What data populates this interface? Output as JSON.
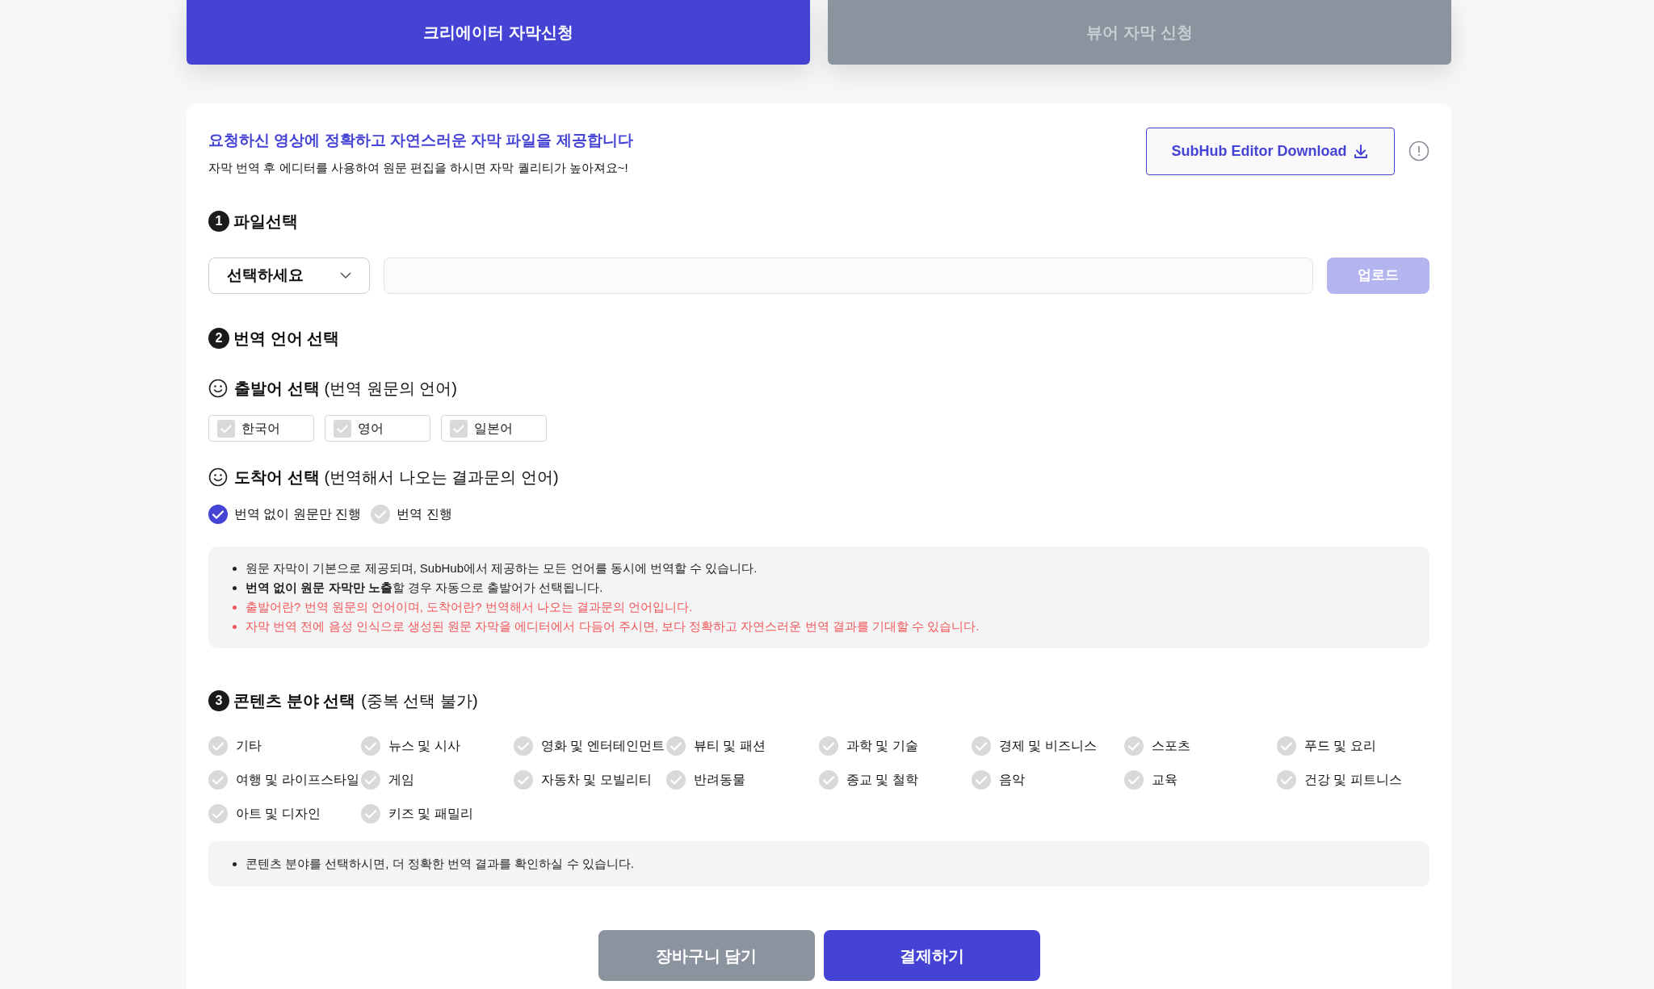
{
  "tabs": [
    {
      "label": "크리에이터 자막신청",
      "selected": true
    },
    {
      "label": "뷰어 자막 신청",
      "selected": false
    }
  ],
  "intro": {
    "title": "요청하신 영상에 정확하고 자연스러운 자막 파일을 제공합니다",
    "subtitle": "자막 번역 후 에디터를 사용하여 원문 편집을 하시면 자막 퀄리티가 높아져요~!",
    "download_button": "SubHub Editor Download"
  },
  "file_section": {
    "number": "1",
    "title": "파일선택",
    "select": "선택하세요",
    "upload_button": "업로드",
    "upload_disabled": true
  },
  "language_section": {
    "number": "2",
    "title": "번역 언어 선택",
    "source": {
      "title": "출발어 선택",
      "hint": "(번역 원문의 언어)",
      "options": [
        {
          "label": "한국어",
          "checked": false
        },
        {
          "label": "영어",
          "checked": false
        },
        {
          "label": "일본어",
          "checked": false
        }
      ]
    },
    "target": {
      "title": "도착어 선택",
      "hint": "(번역해서 나오는 결과문의 언어)",
      "options": [
        {
          "label": "번역 없이 원문만 진행",
          "selected": true
        },
        {
          "label": "번역 진행",
          "selected": false
        }
      ]
    },
    "notes": [
      {
        "kind": "plain",
        "text": "원문 자막이 기본으로 제공되며, SubHub에서 제공하는 모든 언어를 동시에 번역할 수 있습니다."
      },
      {
        "kind": "plain",
        "text": "**번역 없이 원문 자막만 노출**할 경우 자동으로 출발어가 선택됩니다."
      },
      {
        "kind": "warning",
        "text": "출발어란? 번역 원문의 언어이며, 도착어란? 번역해서 나오는 결과문의 언어입니다."
      },
      {
        "kind": "warning",
        "text": "자막 번역 전에 음성 인식으로 생성된 원문 자막을 에디터에서 다듬어 주시면, 보다 정확하고 자연스러운 번역 결과를 기대할 수 있습니다."
      }
    ]
  },
  "content_section": {
    "number": "3",
    "title": "콘텐츠 분야 선택",
    "hint": "(중복 선택 불가)",
    "categories": [
      {
        "label": "기타",
        "selected": false
      },
      {
        "label": "뉴스 및 시사",
        "selected": false
      },
      {
        "label": "영화 및 엔터테인먼트",
        "selected": false
      },
      {
        "label": "뷰티 및 패션",
        "selected": false
      },
      {
        "label": "과학 및 기술",
        "selected": false
      },
      {
        "label": "경제 및 비즈니스",
        "selected": false
      },
      {
        "label": "스포츠",
        "selected": false
      },
      {
        "label": "푸드 및 요리",
        "selected": false
      },
      {
        "label": "여행 및 라이프스타일",
        "selected": false
      },
      {
        "label": "게임",
        "selected": false
      },
      {
        "label": "자동차 및 모빌리티",
        "selected": false
      },
      {
        "label": "반려동물",
        "selected": false
      },
      {
        "label": "종교 및 철학",
        "selected": false
      },
      {
        "label": "음악",
        "selected": false
      },
      {
        "label": "교육",
        "selected": false
      },
      {
        "label": "건강 및 피트니스",
        "selected": false
      },
      {
        "label": "아트 및 디자인",
        "selected": false
      },
      {
        "label": "키즈 및 패밀리",
        "selected": false
      }
    ],
    "notes": [
      {
        "kind": "plain",
        "text": "콘텐츠 분야를 선택하시면, 더 정확한 번역 결과를 확인하실 수 있습니다."
      }
    ]
  },
  "actions": [
    {
      "kind": "secondary",
      "label": "장바구니 담기"
    },
    {
      "kind": "primary",
      "label": "결제하기"
    }
  ]
}
